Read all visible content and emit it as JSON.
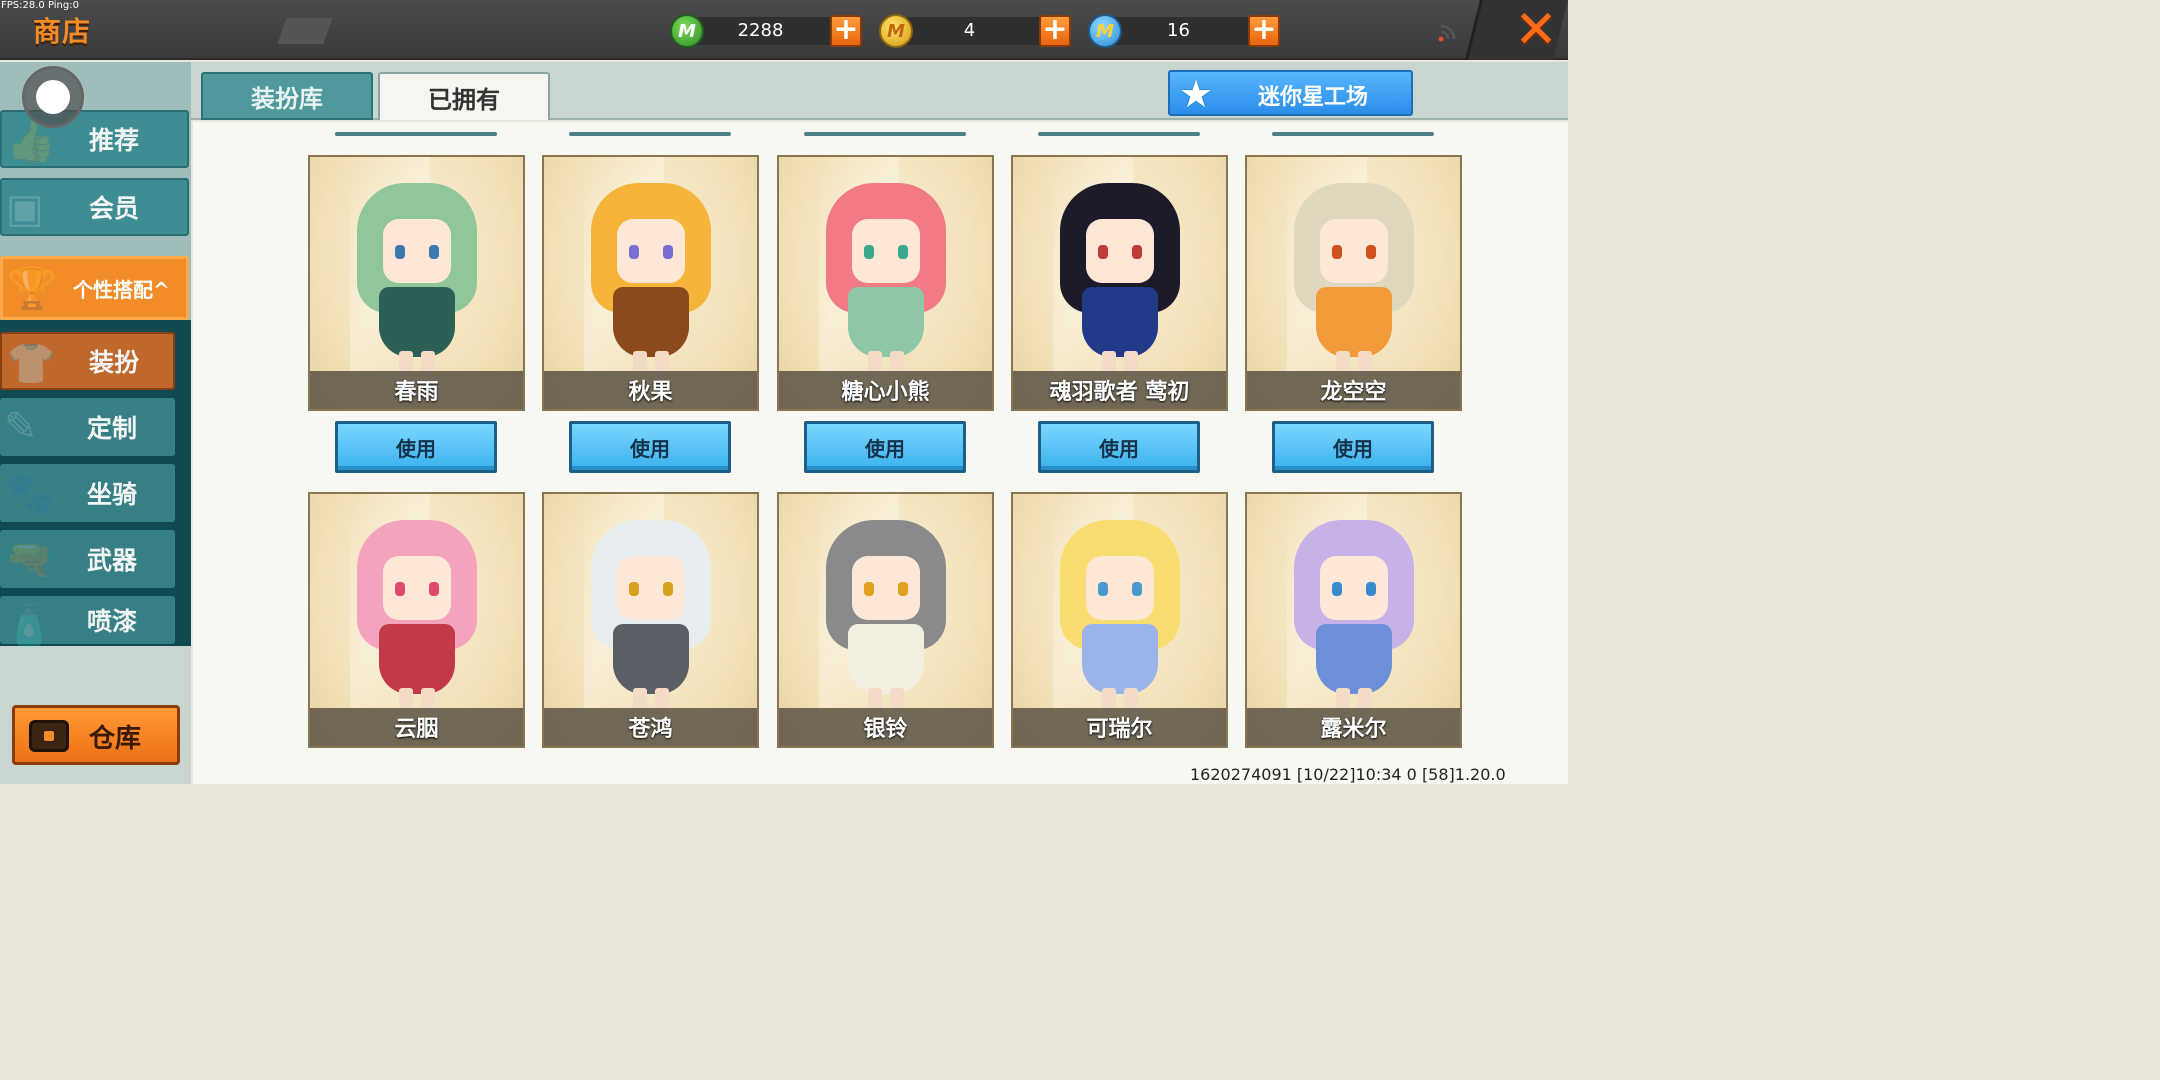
{
  "debug": {
    "fps_text": "FPS:28.0  Ping:0"
  },
  "header": {
    "title": "商店",
    "currencies": [
      {
        "icon": "green-m-coin-icon",
        "value": "2288",
        "color": "#3ca83a",
        "glyph": "M"
      },
      {
        "icon": "gold-m-coin-icon",
        "value": "4",
        "color": "#f0c030",
        "glyph": "M"
      },
      {
        "icon": "blue-m-coin-icon",
        "value": "16",
        "color": "#3aa0ea",
        "glyph": "M"
      }
    ],
    "plus_label": "+",
    "close_label": "✕"
  },
  "sidebar": {
    "items": [
      {
        "label": "推荐",
        "icon": "thumbs-up-icon"
      },
      {
        "label": "会员",
        "icon": "vip-icon"
      },
      {
        "label": "个性搭配",
        "arrow": "^",
        "icon": "trophy-icon"
      },
      {
        "label": "装扮",
        "icon": "shirt-icon"
      },
      {
        "label": "定制",
        "icon": "pencil-ruler-icon"
      },
      {
        "label": "坐骑",
        "icon": "mount-icon"
      },
      {
        "label": "武器",
        "icon": "gun-icon"
      },
      {
        "label": "喷漆",
        "icon": "spray-can-icon"
      }
    ],
    "warehouse_label": "仓库"
  },
  "tabs": [
    {
      "label": "装扮库",
      "active": false
    },
    {
      "label": "已拥有",
      "active": true
    }
  ],
  "workshop_label": "迷你星工场",
  "use_label": "使用",
  "skins_row1": [
    {
      "name": "春雨",
      "hair": "#8fc79a",
      "outfit": "#2c5f55",
      "eye": "#3a7ab0"
    },
    {
      "name": "秋果",
      "hair": "#f5b53a",
      "outfit": "#8a4a1c",
      "eye": "#7a6fd0"
    },
    {
      "name": "糖心小熊",
      "hair": "#f27a86",
      "outfit": "#8ec7a8",
      "eye": "#3aa78f"
    },
    {
      "name": "魂羽歌者 莺初",
      "hair": "#1d1a2a",
      "outfit": "#223a8a",
      "eye": "#c03a3a"
    },
    {
      "name": "龙空空",
      "hair": "#dfd8bf",
      "outfit": "#f29a3a",
      "eye": "#d05020"
    }
  ],
  "skins_row2": [
    {
      "name": "云胭",
      "hair": "#f4a3bd",
      "outfit": "#c23a4a",
      "eye": "#e04a6a"
    },
    {
      "name": "苍鸿",
      "hair": "#e8eef0",
      "outfit": "#5a5f66",
      "eye": "#d9a020"
    },
    {
      "name": "银铃",
      "hair": "#8a8a8a",
      "outfit": "#f3efe0",
      "eye": "#e0a020"
    },
    {
      "name": "可瑞尔",
      "hair": "#f9dd70",
      "outfit": "#9ab3e8",
      "eye": "#4a9ad0"
    },
    {
      "name": "露米尔",
      "hair": "#c8b0e8",
      "outfit": "#6c8fd8",
      "eye": "#3a8ad0"
    }
  ],
  "footer_text": "1620274091   [10/22]10:34 0   [58]1.20.0"
}
